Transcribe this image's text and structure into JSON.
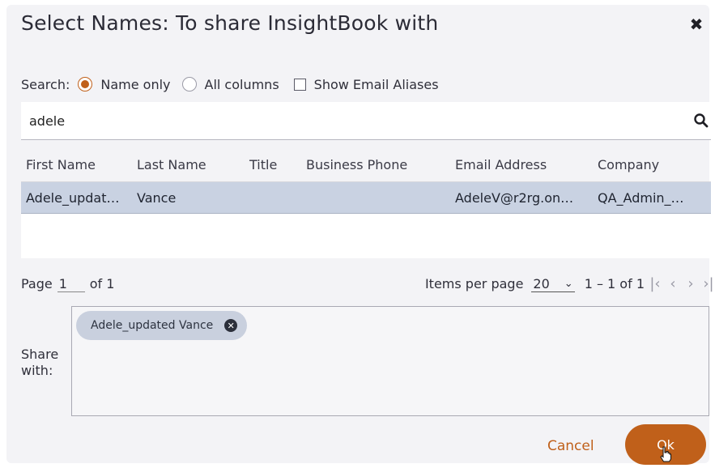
{
  "dialog": {
    "title": "Select Names: To share InsightBook with",
    "close_glyph": "✖"
  },
  "search": {
    "label": "Search:",
    "options": [
      {
        "label": "Name only",
        "selected": true
      },
      {
        "label": "All columns",
        "selected": false
      }
    ],
    "show_email_aliases": {
      "label": "Show Email Aliases",
      "checked": false
    },
    "query": "adele",
    "icon": "search-icon"
  },
  "table": {
    "columns": [
      "First Name",
      "Last Name",
      "Title",
      "Business Phone",
      "Email Address",
      "Company"
    ],
    "rows": [
      {
        "first": "Adele_updat…",
        "last": "Vance",
        "title": "",
        "phone": "",
        "email": "AdeleV@r2rg.on…",
        "company": "QA_Admin_…",
        "selected": true
      }
    ]
  },
  "pager": {
    "page_label": "Page",
    "page_value": "1",
    "of_label": "of 1",
    "items_per_page_label": "Items per page",
    "items_per_page_value": "20",
    "range": "1 – 1 of 1"
  },
  "share": {
    "label": "Share with:",
    "chips": [
      {
        "label": "Adele_updated Vance"
      }
    ]
  },
  "buttons": {
    "cancel": "Cancel",
    "ok": "Ok"
  },
  "colors": {
    "accent": "#c0601a",
    "selected_row": "#c9d2e2",
    "chip": "#c9d0de"
  }
}
